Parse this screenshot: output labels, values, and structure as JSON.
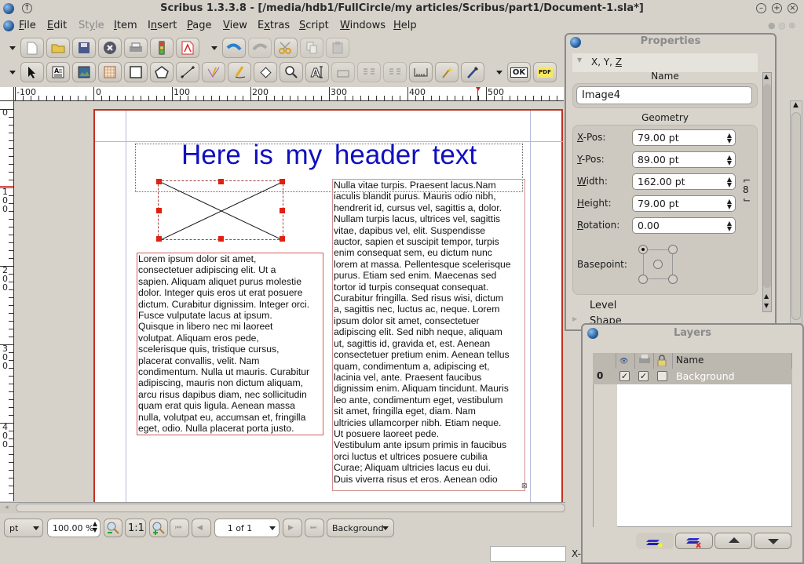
{
  "window": {
    "title": "Scribus 1.3.3.8 - [/media/hdb1/FullCircle/my articles/Scribus/part1/Document-1.sla*]",
    "controls": [
      "minimize",
      "maximize",
      "close"
    ]
  },
  "menubar": {
    "items": [
      {
        "label": "File",
        "mnemonic": "F",
        "enabled": true
      },
      {
        "label": "Edit",
        "mnemonic": "E",
        "enabled": true
      },
      {
        "label": "Style",
        "mnemonic": "y",
        "enabled": false
      },
      {
        "label": "Item",
        "mnemonic": "I",
        "enabled": true
      },
      {
        "label": "Insert",
        "mnemonic": "n",
        "enabled": true
      },
      {
        "label": "Page",
        "mnemonic": "P",
        "enabled": true
      },
      {
        "label": "View",
        "mnemonic": "V",
        "enabled": true
      },
      {
        "label": "Extras",
        "mnemonic": "x",
        "enabled": true
      },
      {
        "label": "Script",
        "mnemonic": "S",
        "enabled": true
      },
      {
        "label": "Windows",
        "mnemonic": "W",
        "enabled": true
      },
      {
        "label": "Help",
        "mnemonic": "H",
        "enabled": true
      }
    ]
  },
  "toolbar_file": [
    "new-document",
    "open",
    "save",
    "close",
    "print",
    "preflight-verifier",
    "export-pdf"
  ],
  "toolbar_edit": [
    "undo",
    "redo",
    "cut",
    "copy",
    "paste"
  ],
  "toolbar_tools": [
    "select",
    "text-frame",
    "image-frame",
    "table",
    "shape",
    "polygon",
    "line",
    "bezier-curve",
    "freehand-line",
    "rotate",
    "zoom",
    "edit-text",
    "edit-contents",
    "link-text-frames",
    "unlink-text-frames",
    "measurements",
    "copy-properties",
    "eyedropper"
  ],
  "toolbar_pdf": [
    "pdf-push-button",
    "pdf-field"
  ],
  "pdf_buttons": {
    "ok": "OK",
    "pdf": "PDF"
  },
  "rulers": {
    "horizontal_labels": [
      "-100",
      "0",
      "100",
      "200",
      "300",
      "400",
      "500"
    ],
    "vertical_labels": [
      "0",
      "100",
      "200",
      "300",
      "400"
    ]
  },
  "document": {
    "header_text": "Here is my header text",
    "left_text": "Lorem ipsum dolor sit amet,\nconsectetuer adipiscing elit. Ut a\nsapien. Aliquam aliquet purus molestie\ndolor. Integer quis eros ut erat posuere\ndictum. Curabitur dignissim. Integer orci.\nFusce vulputate lacus at ipsum.\nQuisque in libero nec mi laoreet\nvolutpat. Aliquam eros pede,\nscelerisque quis, tristique cursus,\nplacerat convallis, velit. Nam\ncondimentum. Nulla ut mauris. Curabitur\nadipiscing, mauris non dictum aliquam,\narcu risus dapibus diam, nec sollicitudin\nquam erat quis ligula. Aenean massa\nnulla, volutpat eu, accumsan et, fringilla\neget, odio. Nulla placerat porta justo.",
    "right_text": "Nulla vitae turpis. Praesent lacus.Nam\niaculis blandit purus. Mauris odio nibh,\nhendrerit id, cursus vel, sagittis a, dolor.\nNullam turpis lacus, ultrices vel, sagittis\nvitae, dapibus vel, elit. Suspendisse\nauctor, sapien et suscipit tempor, turpis\nenim consequat sem, eu dictum nunc\nlorem at massa. Pellentesque scelerisque\npurus. Etiam sed enim. Maecenas sed\ntortor id turpis consequat consequat.\nCurabitur fringilla. Sed risus wisi, dictum\na, sagittis nec, luctus ac, neque. Lorem\nipsum dolor sit amet, consectetuer\nadipiscing elit. Sed nibh neque, aliquam\nut, sagittis id, gravida et, est. Aenean\nconsectetuer pretium enim. Aenean tellus\nquam, condimentum a, adipiscing et,\nlacinia vel, ante. Praesent faucibus\ndignissim enim. Aliquam tincidunt. Mauris\nleo ante, condimentum eget, vestibulum\nsit amet, fringilla eget, diam. Nam\nultricies ullamcorper nibh. Etiam neque.\nUt posuere laoreet pede.\nVestibulum ante ipsum primis in faucibus\norci luctus et ultrices posuere cubilia\nCurae; Aliquam ultricies lacus eu dui.\nDuis viverra risus et eros. Aenean odio"
  },
  "statusbar": {
    "unit": "pt",
    "zoom": "100.00 %",
    "zoom_actual": "1:1",
    "page": "1 of 1",
    "layer": "Background",
    "coord_label": "X-"
  },
  "properties": {
    "title": "Properties",
    "section_xyz": "X, Y, Z",
    "name_label": "Name",
    "name_value": "Image4",
    "geometry_label": "Geometry",
    "fields": [
      {
        "label": "X-Pos:",
        "value": "79.00 pt"
      },
      {
        "label": "Y-Pos:",
        "value": "89.00 pt"
      },
      {
        "label": "Width:",
        "value": "162.00 pt"
      },
      {
        "label": "Height:",
        "value": "79.00 pt"
      },
      {
        "label": "Rotation:",
        "value": "0.00"
      }
    ],
    "basepoint_label": "Basepoint:",
    "basepoint_selected": "top-left",
    "level_label": "Level",
    "shape_label": "Shape"
  },
  "layers": {
    "title": "Layers",
    "columns": [
      "visible",
      "printable",
      "locked",
      "Name"
    ],
    "rows": [
      {
        "index": "0",
        "visible": true,
        "printable": true,
        "locked": false,
        "name": "Background"
      }
    ],
    "buttons": [
      "add-layer",
      "delete-layer",
      "raise-layer",
      "lower-layer"
    ]
  }
}
